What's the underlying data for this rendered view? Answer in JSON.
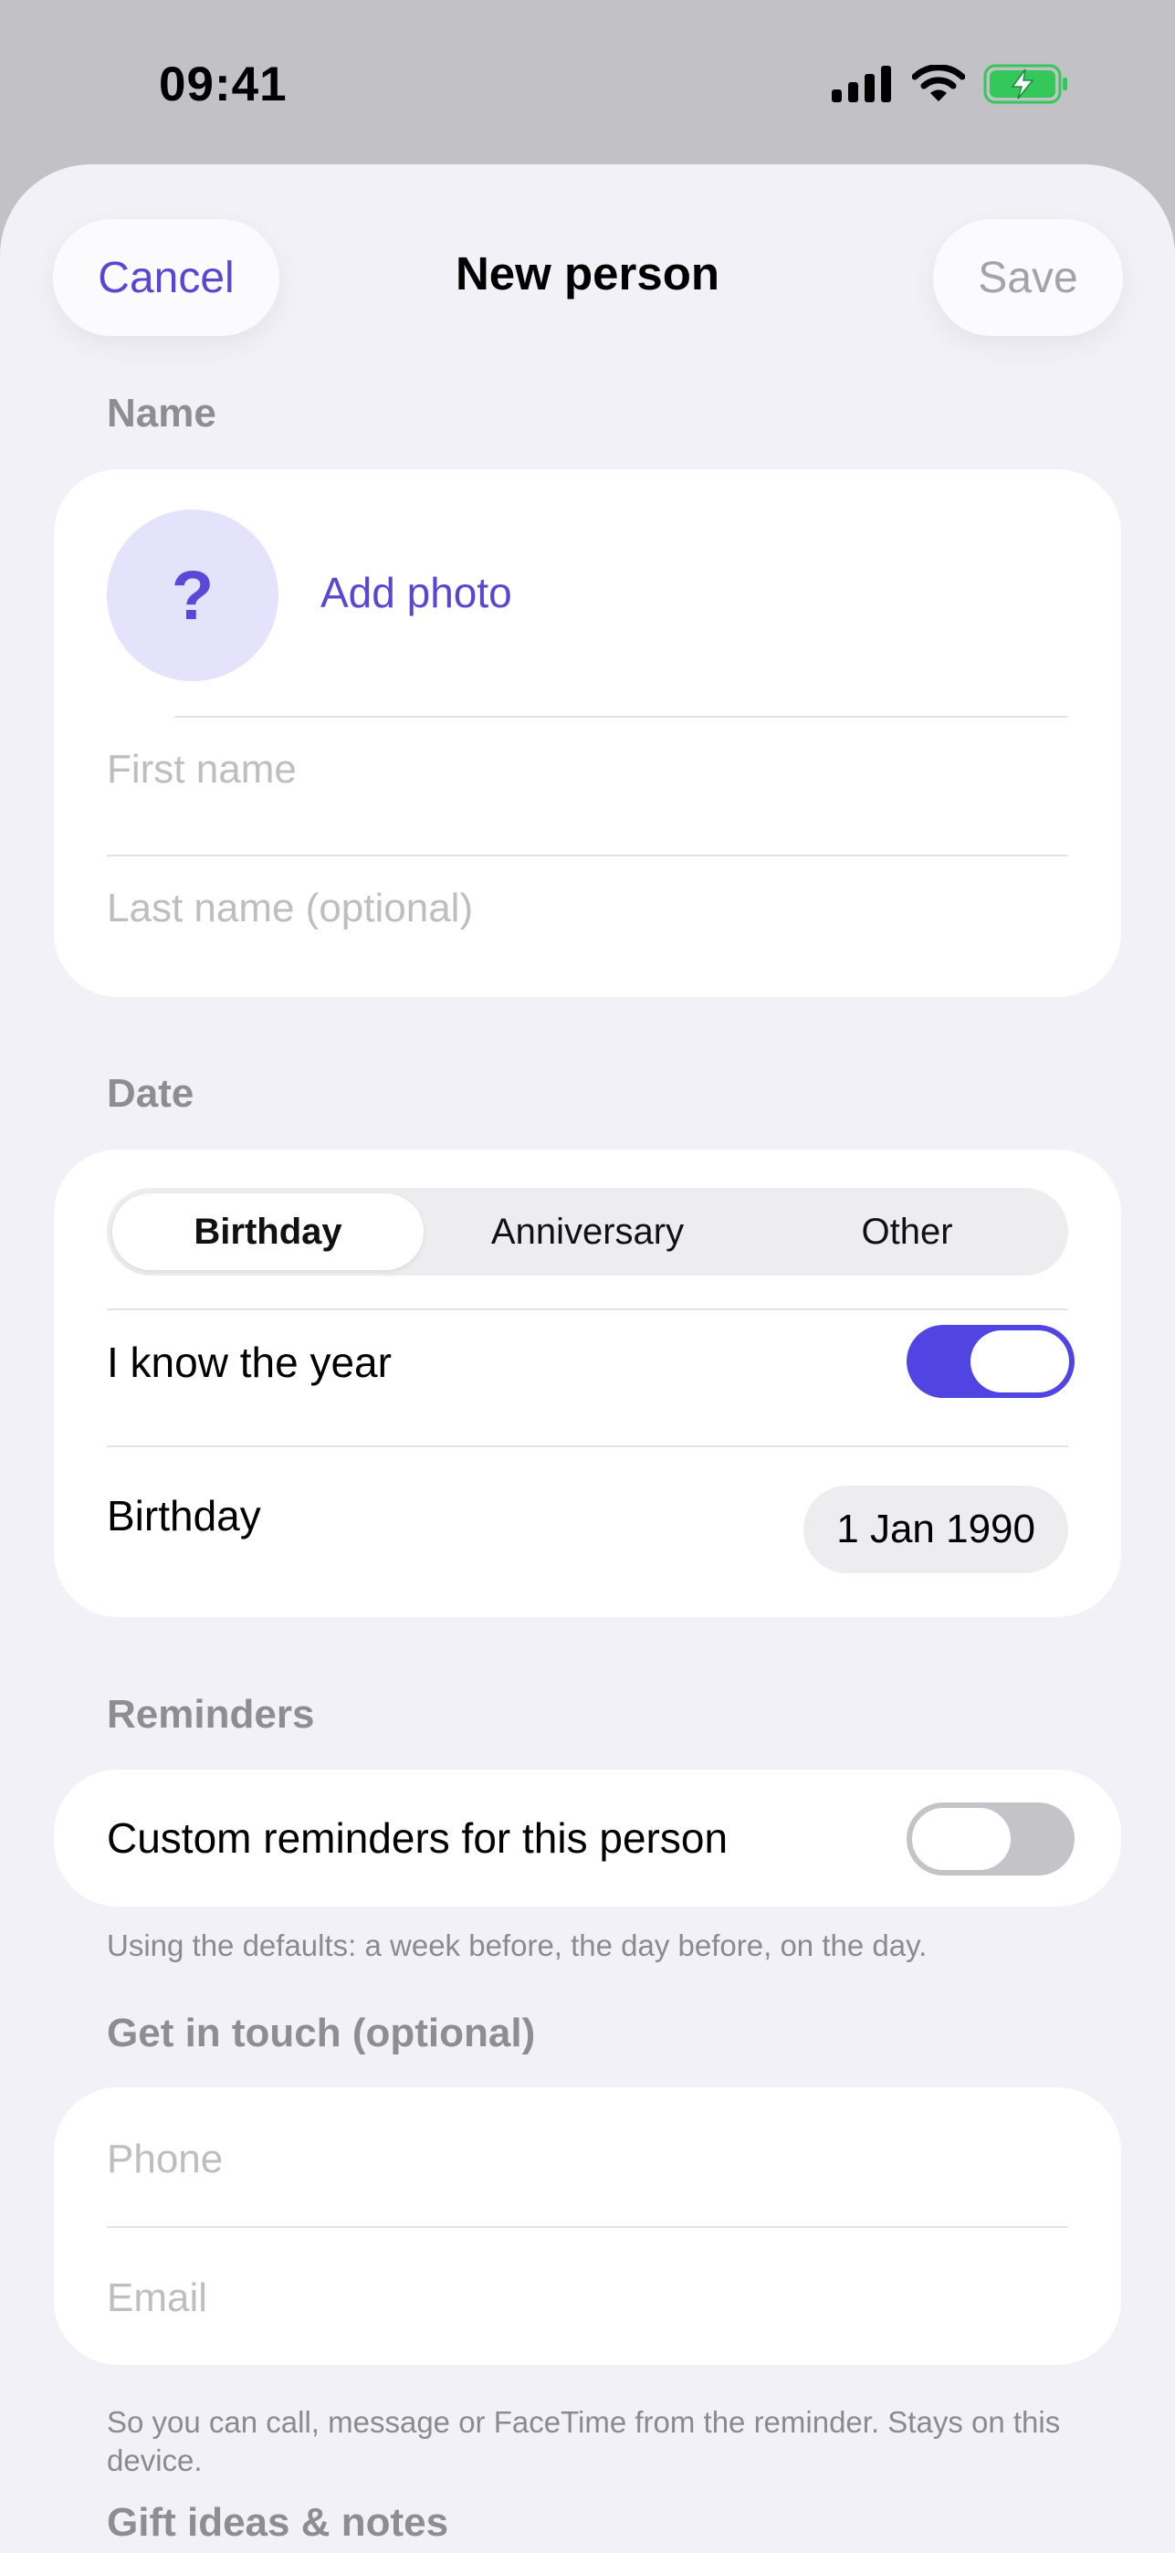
{
  "status_bar": {
    "time": "09:41",
    "icons": [
      "signal-icon",
      "wifi-icon",
      "battery-charging-icon"
    ],
    "battery_color": "#34c759"
  },
  "nav": {
    "cancel_label": "Cancel",
    "title": "New person",
    "save_label": "Save"
  },
  "name_section": {
    "label": "Name",
    "avatar_glyph": "?",
    "add_photo_label": "Add photo",
    "first_name_placeholder": "First name",
    "last_name_placeholder": "Last name (optional)"
  },
  "date_section": {
    "label": "Date",
    "segments": [
      "Birthday",
      "Anniversary",
      "Other"
    ],
    "selected_segment": "Birthday",
    "know_year_label": "I know the year",
    "know_year_on": true,
    "date_row_label": "Birthday",
    "date_value": "1 Jan 1990"
  },
  "reminders_section": {
    "label": "Reminders",
    "custom_label": "Custom reminders for this person",
    "custom_on": false,
    "footnote": "Using the defaults: a week before, the day before, on the day."
  },
  "contact_section": {
    "label": "Get in touch (optional)",
    "phone_placeholder": "Phone",
    "email_placeholder": "Email",
    "footnote": "So you can call, message or FaceTime from the reminder. Stays on this device."
  },
  "notes_section": {
    "label": "Gift ideas & notes"
  },
  "colors": {
    "accent": "#5045e2",
    "sheet_background": "#f2f1f7",
    "placeholder": "#bdbdc2"
  }
}
